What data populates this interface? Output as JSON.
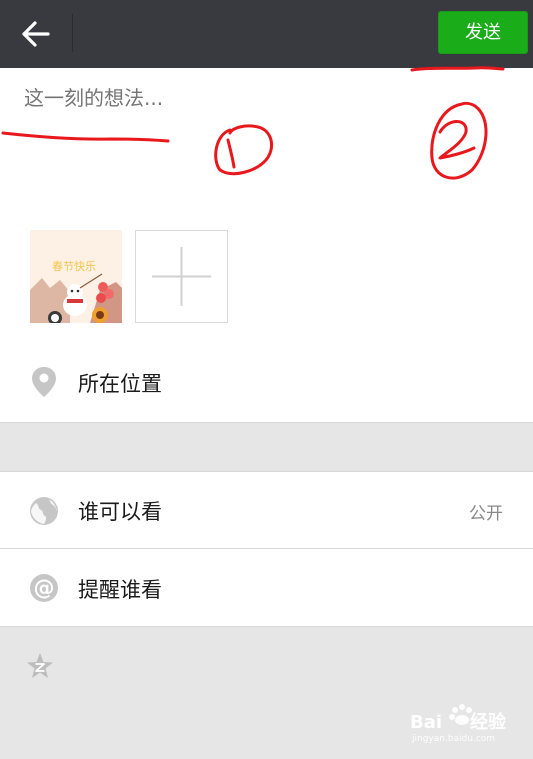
{
  "header": {
    "send_label": "发送",
    "back_icon": "arrow-left-icon"
  },
  "compose": {
    "placeholder": "这一刻的想法...",
    "photo_caption": "春节快乐",
    "add_icon": "plus-icon"
  },
  "options": {
    "location_label": "所在位置",
    "location_icon": "location-pin-icon",
    "visibility_label": "谁可以看",
    "visibility_value": "公开",
    "visibility_icon": "globe-icon",
    "remind_label": "提醒谁看",
    "remind_icon": "at-icon",
    "qzone_icon": "qzone-star-icon"
  },
  "annotations": {
    "mark_1": "1",
    "mark_2": "2",
    "color": "#e8181c"
  },
  "watermark": {
    "brand": "Bai",
    "brand_cn": "经验",
    "url": "jingyan.baidu.com"
  },
  "colors": {
    "topbar": "#393a3f",
    "send_button": "#1aad19",
    "background": "#e6e6e6"
  }
}
